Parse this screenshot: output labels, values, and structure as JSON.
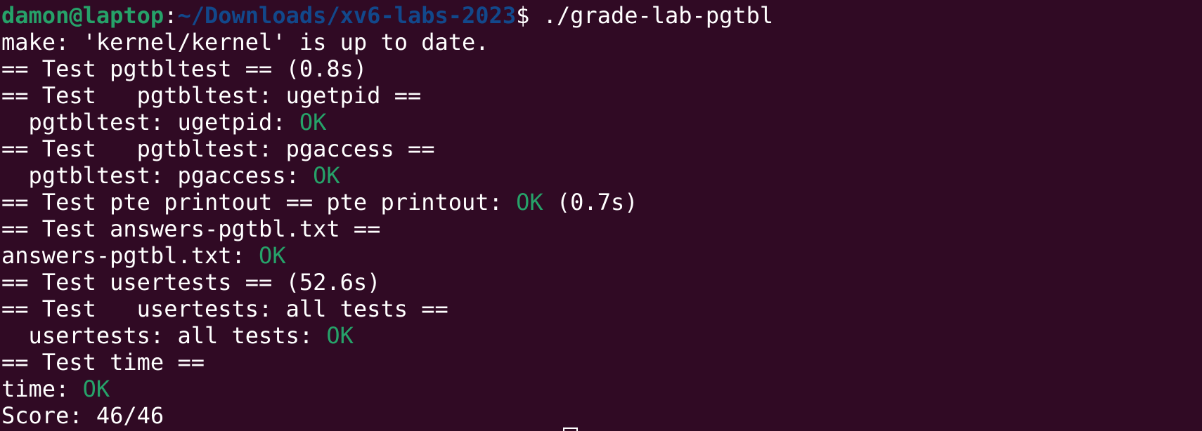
{
  "colors": {
    "background": "#300a24",
    "foreground": "#ffffff",
    "ok": "#26a269",
    "prompt_user": "#26a269",
    "prompt_path": "#12488b"
  },
  "prompt": {
    "user_host": "damon@laptop",
    "separator": ":",
    "path": "~/Downloads/xv6-labs-2023",
    "symbol": "$ ",
    "command": "./grade-lab-pgtbl"
  },
  "lines": [
    {
      "text": "make: 'kernel/kernel' is up to date.",
      "status": "",
      "suffix": ""
    },
    {
      "text": "== Test pgtbltest == (0.8s)",
      "status": "",
      "suffix": ""
    },
    {
      "text": "== Test   pgtbltest: ugetpid ==",
      "status": "",
      "suffix": ""
    },
    {
      "text": "  pgtbltest: ugetpid: ",
      "status": "OK",
      "suffix": ""
    },
    {
      "text": "== Test   pgtbltest: pgaccess ==",
      "status": "",
      "suffix": ""
    },
    {
      "text": "  pgtbltest: pgaccess: ",
      "status": "OK",
      "suffix": ""
    },
    {
      "text": "== Test pte printout == pte printout: ",
      "status": "OK",
      "suffix": " (0.7s)"
    },
    {
      "text": "== Test answers-pgtbl.txt ==",
      "status": "",
      "suffix": ""
    },
    {
      "text": "answers-pgtbl.txt: ",
      "status": "OK",
      "suffix": ""
    },
    {
      "text": "== Test usertests == (52.6s)",
      "status": "",
      "suffix": ""
    },
    {
      "text": "== Test   usertests: all tests ==",
      "status": "",
      "suffix": ""
    },
    {
      "text": "  usertests: all tests: ",
      "status": "OK",
      "suffix": ""
    },
    {
      "text": "== Test time ==",
      "status": "",
      "suffix": ""
    },
    {
      "text": "time: ",
      "status": "OK",
      "suffix": ""
    },
    {
      "text": "Score: 46/46",
      "status": "",
      "suffix": ""
    }
  ]
}
